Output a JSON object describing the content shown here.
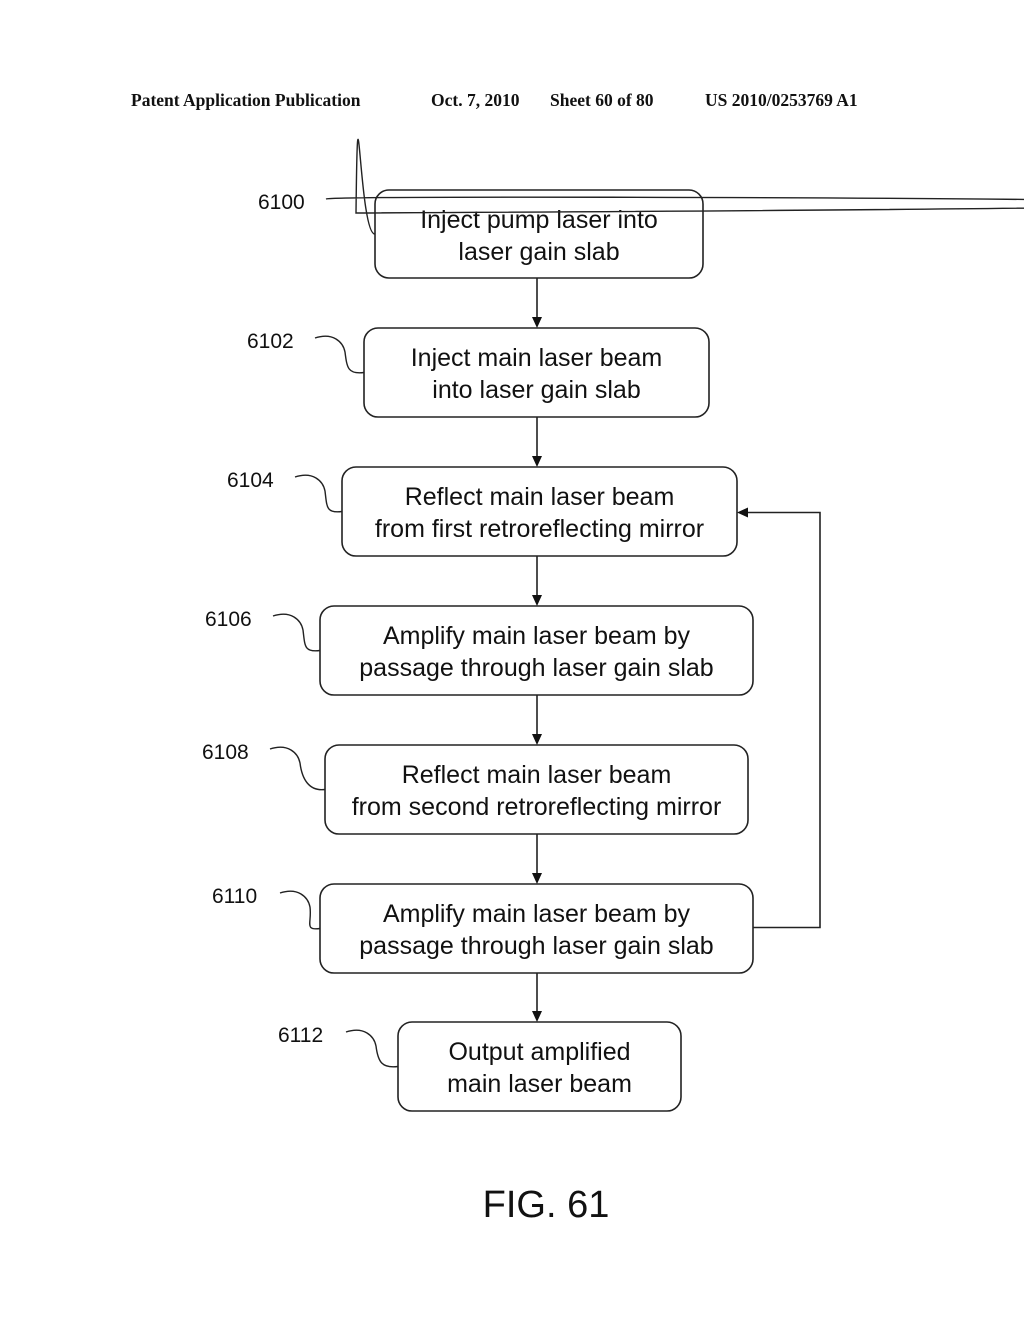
{
  "header": {
    "publication": "Patent Application Publication",
    "date": "Oct. 7, 2010",
    "sheet": "Sheet 60 of 80",
    "number": "US 2010/0253769 A1"
  },
  "steps": [
    {
      "ref": "6100",
      "lines": [
        "Inject pump laser into",
        "laser gain slab"
      ]
    },
    {
      "ref": "6102",
      "lines": [
        "Inject main laser beam",
        "into laser gain slab"
      ]
    },
    {
      "ref": "6104",
      "lines": [
        "Reflect main laser beam",
        "from first retroreflecting mirror"
      ]
    },
    {
      "ref": "6106",
      "lines": [
        "Amplify main laser beam by",
        "passage through laser gain slab"
      ]
    },
    {
      "ref": "6108",
      "lines": [
        "Reflect main laser beam",
        "from second retroreflecting mirror"
      ]
    },
    {
      "ref": "6110",
      "lines": [
        "Amplify main laser beam by",
        "passage through laser gain slab"
      ]
    },
    {
      "ref": "6112",
      "lines": [
        "Output amplified",
        "main laser beam"
      ]
    }
  ],
  "flow": {
    "sequence": [
      "6100",
      "6102",
      "6104",
      "6106",
      "6108",
      "6110",
      "6112"
    ],
    "feedback": {
      "from": "6110",
      "to": "6104"
    }
  },
  "figure_label": "FIG. 61"
}
